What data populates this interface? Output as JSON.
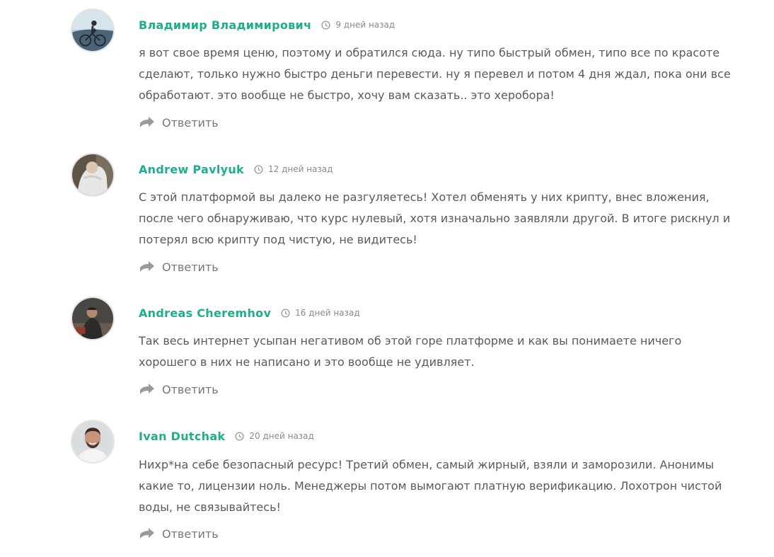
{
  "comments": [
    {
      "author": "Владимир Владимирович",
      "time": "9 дней назад",
      "text": "я вот свое время ценю, поэтому и обратился сюда. ну типо быстрый обмен, типо все по красоте сделают, только нужно быстро деньги перевести. ну я перевел и потом 4 дня ждал, пока они все обработают. это вообще не быстро, хочу вам сказать.. это херобора!",
      "reply": "Ответить"
    },
    {
      "author": "Andrew Pavlyuk",
      "time": "12 дней назад",
      "text": "С этой платформой вы далеко не разгуляетесь! Хотел обменять у них крипту, внес вложения, после чего обнаруживаю, что курс нулевый, хотя изначально заявляли другой. В итоге рискнул и потерял всю крипту под чистую, не видитесь!",
      "reply": "Ответить"
    },
    {
      "author": "Andreas Cheremhov",
      "time": "16 дней назад",
      "text": "Так весь интернет усыпан негативом об этой горе платформе и как вы понимаете ничего хорошего в них не написано и это вообще не удивляет.",
      "reply": "Ответить"
    },
    {
      "author": "Ivan Dutchak",
      "time": "20 дней назад",
      "text": "Нихр*на себе безопасный ресурс! Третий обмен, самый жирный, взяли и заморозили. Анонимы какие то, лицензии ноль. Менеджеры потом вымогают платную верификацию. Лохотрон чистой воды, не связывайтесь!",
      "reply": "Ответить"
    }
  ],
  "colors": {
    "author": "#1fad8b",
    "text": "#5a5a5a",
    "meta": "#8a8a8a",
    "reply_icon": "#9a9a9a"
  },
  "icons": {
    "time": "clock-icon",
    "reply": "reply-arrow-icon",
    "avatar": "user-photo"
  }
}
